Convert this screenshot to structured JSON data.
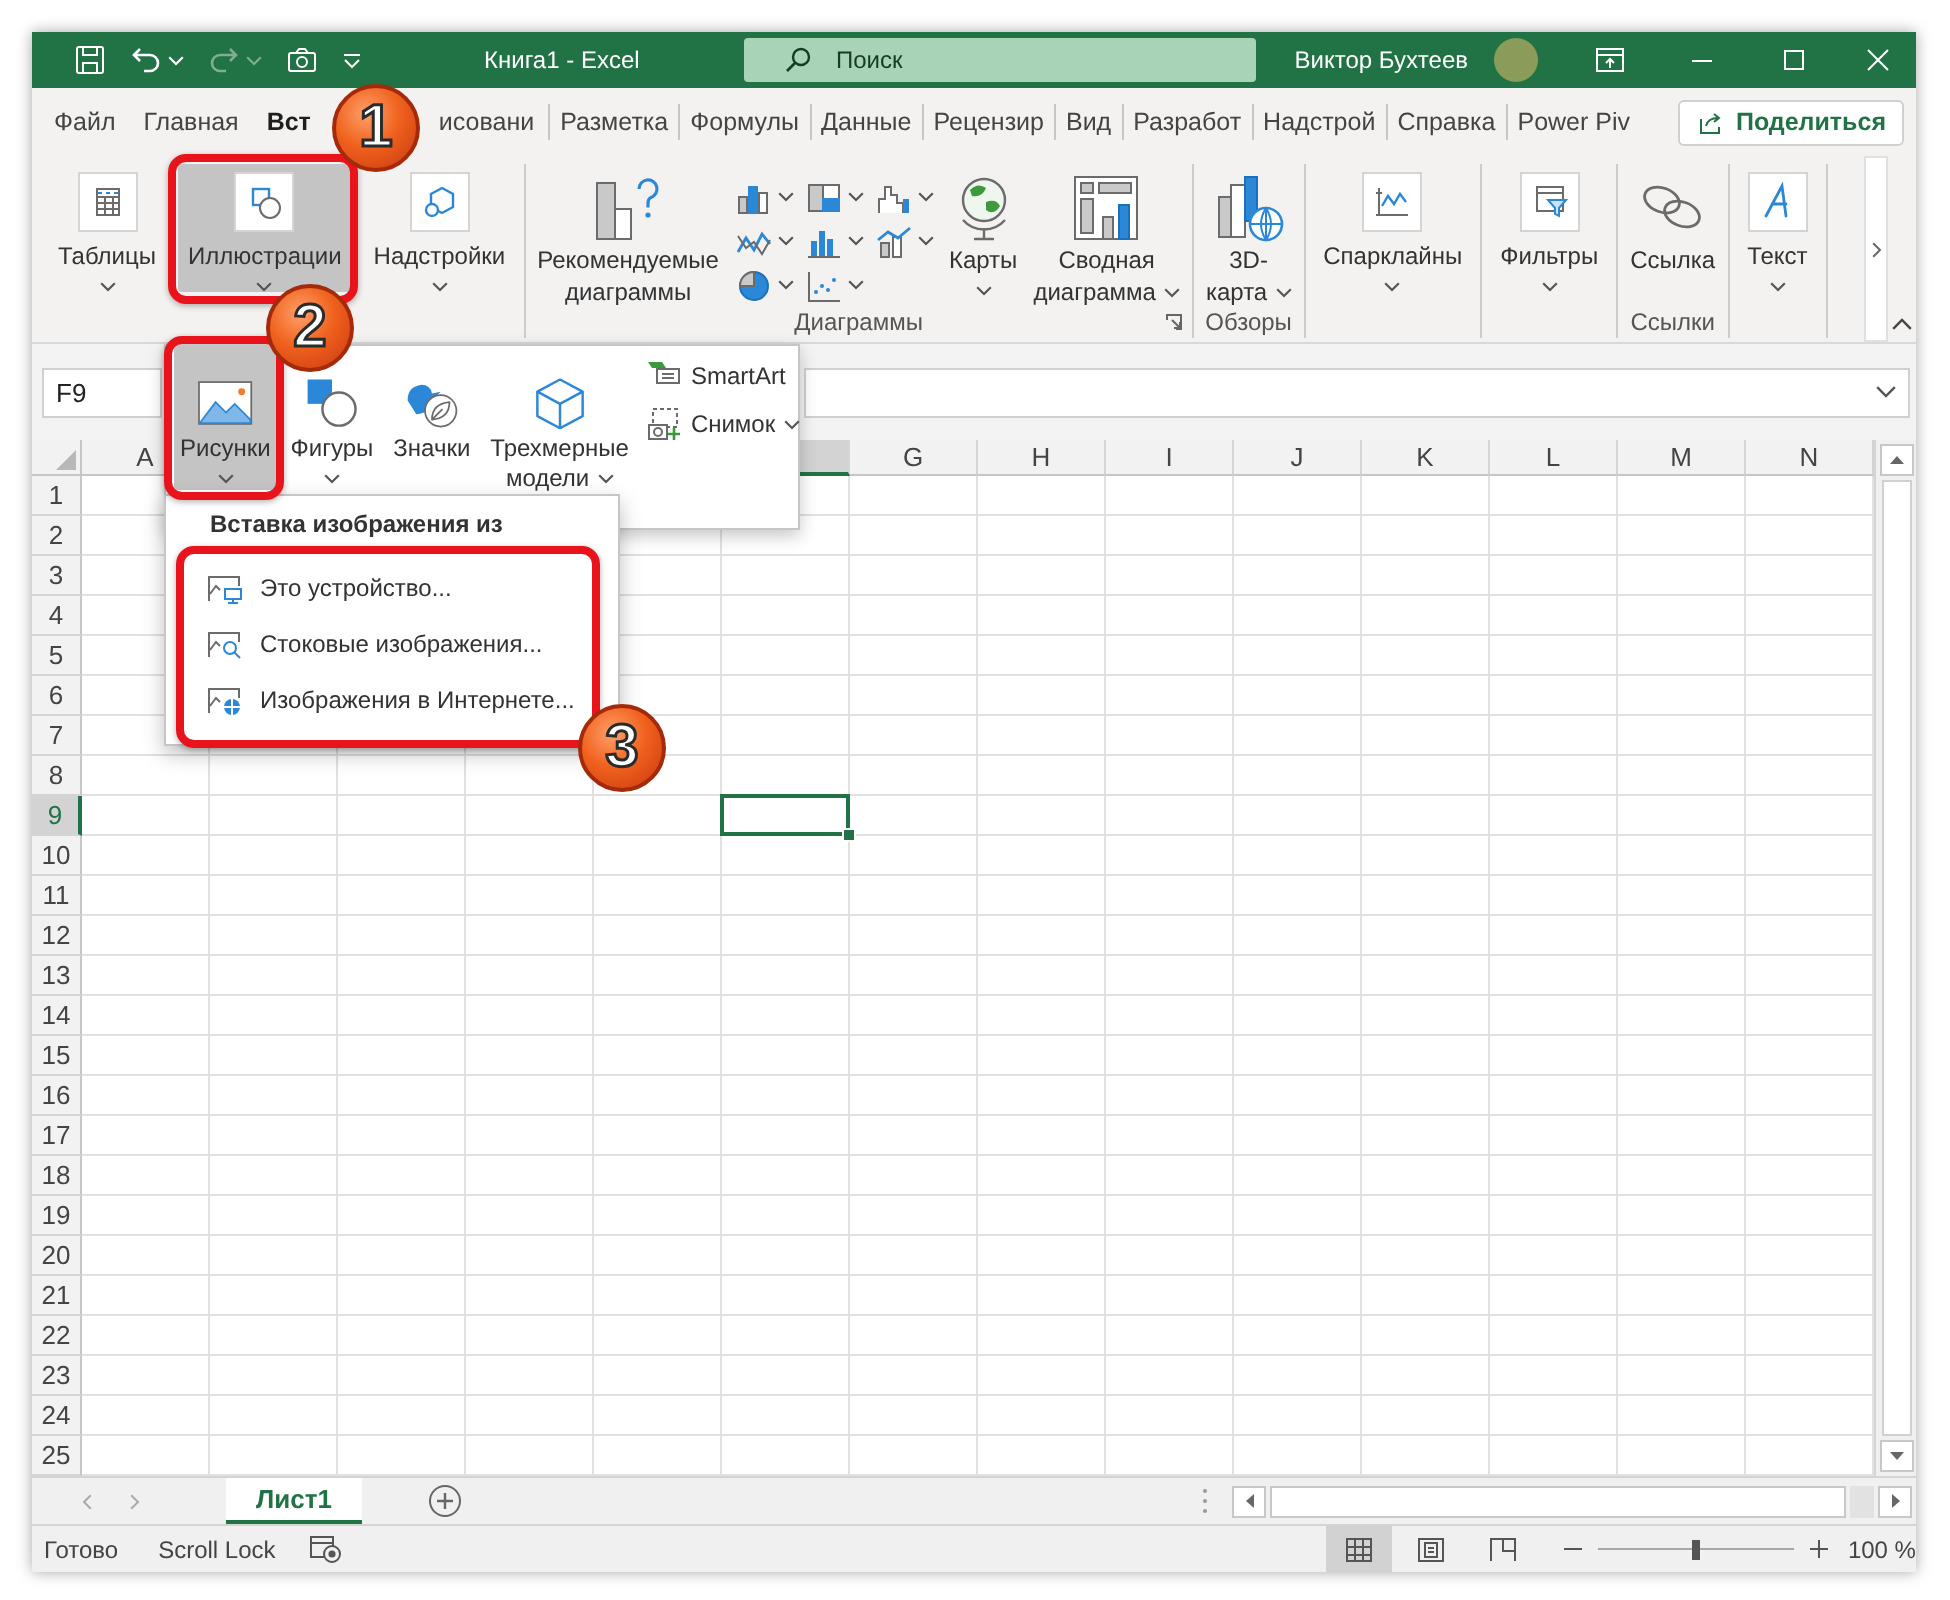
{
  "title_bar": {
    "quick_access": [
      {
        "disabled": false,
        "dropdown": false
      },
      {
        "disabled": false,
        "dropdown": true
      },
      {
        "disabled": true,
        "dropdown": true
      },
      {
        "disabled": false,
        "dropdown": false
      },
      {
        "disabled": false,
        "dropdown": false
      }
    ],
    "title": "Книга1 - Excel",
    "search": {
      "placeholder": "Поиск"
    },
    "user": "Виктор Бухтеев"
  },
  "ribbon_tabs": [
    {
      "label": "Файл",
      "selected": false
    },
    {
      "label": "Главная",
      "selected": false
    },
    {
      "label": "Вст",
      "selected": true
    },
    {
      "label": "исовани",
      "selected": false
    },
    {
      "label": "Разметка",
      "selected": false
    },
    {
      "label": "Формулы",
      "selected": false
    },
    {
      "label": "Данные",
      "selected": false
    },
    {
      "label": "Рецензир",
      "selected": false
    },
    {
      "label": "Вид",
      "selected": false
    },
    {
      "label": "Разработ",
      "selected": false
    },
    {
      "label": "Надстрой",
      "selected": false
    },
    {
      "label": "Справка",
      "selected": false
    },
    {
      "label": "Power Piv",
      "selected": false
    }
  ],
  "share_button": "Поделиться",
  "ribbon_groups": [
    {
      "buttons": [
        {
          "kind": "tile",
          "label": "Таблицы",
          "dropdown": true,
          "pressed": false
        },
        {
          "kind": "tile",
          "label": "Иллюстрации",
          "dropdown": true,
          "pressed": true
        },
        {
          "kind": "tile",
          "label": "Надстройки",
          "dropdown": true,
          "pressed": false
        }
      ]
    },
    {
      "label": "Диаграммы",
      "launcher": true,
      "buttons": [
        {
          "kind": "large",
          "label": "Рекомендуемые\nдиаграммы",
          "dropdown": false,
          "pressed": false
        },
        {
          "kind": "chart-grid",
          "items": [
            {
              "dropdown": true
            },
            {
              "dropdown": true
            },
            {
              "dropdown": true
            },
            {
              "dropdown": true
            },
            {
              "dropdown": true
            },
            {
              "dropdown": true
            },
            {
              "dropdown": true
            },
            {
              "dropdown": true
            }
          ]
        },
        {
          "kind": "large",
          "label": "Карты",
          "dropdown": true,
          "pressed": false
        },
        {
          "kind": "large",
          "label": "Сводная\nдиаграмма",
          "dropdown": true,
          "pressed": false
        }
      ]
    },
    {
      "label": "Обзоры",
      "buttons": [
        {
          "kind": "large",
          "label": "3D-\nкарта",
          "dropdown": true,
          "pressed": false
        }
      ]
    },
    {
      "buttons": [
        {
          "kind": "tile",
          "label": "Спарклайны",
          "dropdown": true,
          "pressed": false
        }
      ]
    },
    {
      "buttons": [
        {
          "kind": "tile",
          "label": "Фильтры",
          "dropdown": true,
          "pressed": false
        }
      ]
    },
    {
      "label": "Ссылки",
      "buttons": [
        {
          "kind": "large",
          "label": "Ссылка",
          "dropdown": false,
          "pressed": false
        }
      ]
    },
    {
      "buttons": [
        {
          "kind": "tile",
          "label": "Текст",
          "dropdown": true,
          "pressed": false
        }
      ]
    }
  ],
  "formula_bar": {
    "name_box": "F9"
  },
  "illustrations_menu": {
    "buttons": [
      {
        "label": "Рисунки",
        "dropdown": true,
        "pressed": true
      },
      {
        "label": "Фигуры",
        "dropdown": true,
        "pressed": false
      },
      {
        "label": "Значки",
        "dropdown": false,
        "pressed": false
      },
      {
        "label": "Трехмерные\nмодели",
        "dropdown": true,
        "pressed": false
      }
    ],
    "side_buttons": [
      {
        "label": "SmartArt",
        "dropdown": false
      },
      {
        "label": "Снимок",
        "dropdown": true
      }
    ]
  },
  "pictures_menu": {
    "header": "Вставка изображения из",
    "items": [
      "Это устройство...",
      "Стоковые изображения...",
      "Изображения в Интернете..."
    ]
  },
  "columns": [
    {
      "label": "A",
      "selected": false
    },
    {},
    {},
    {},
    {},
    {
      "selected": true
    },
    {
      "label": "G",
      "selected": false
    },
    {
      "label": "H",
      "selected": false
    },
    {
      "label": "I",
      "selected": false
    },
    {
      "label": "J",
      "selected": false
    },
    {
      "label": "K",
      "selected": false
    },
    {
      "label": "L",
      "selected": false
    },
    {
      "label": "M",
      "selected": false
    },
    {
      "label": "N",
      "selected": false
    }
  ],
  "rows": [
    {
      "label": "1",
      "selected": false
    },
    {
      "label": "2",
      "selected": false
    },
    {
      "label": "3",
      "selected": false
    },
    {
      "label": "4",
      "selected": false
    },
    {
      "label": "5",
      "selected": false
    },
    {
      "label": "6",
      "selected": false
    },
    {
      "label": "7",
      "selected": false
    },
    {
      "label": "8",
      "selected": false
    },
    {
      "label": "9",
      "selected": true
    },
    {
      "label": "10",
      "selected": false
    },
    {
      "label": "11",
      "selected": false
    },
    {
      "label": "12",
      "selected": false
    },
    {
      "label": "13",
      "selected": false
    },
    {
      "label": "14",
      "selected": false
    },
    {
      "label": "15",
      "selected": false
    },
    {
      "label": "16",
      "selected": false
    },
    {
      "label": "17",
      "selected": false
    },
    {
      "label": "18",
      "selected": false
    },
    {
      "label": "19",
      "selected": false
    },
    {
      "label": "20",
      "selected": false
    },
    {
      "label": "21",
      "selected": false
    },
    {
      "label": "22",
      "selected": false
    },
    {
      "label": "23",
      "selected": false
    },
    {
      "label": "24",
      "selected": false
    },
    {
      "label": "25",
      "selected": false
    }
  ],
  "sheet_tabs": [
    {
      "label": "Лист1",
      "selected": true
    }
  ],
  "status_bar": {
    "status": "Готово",
    "scroll_lock": "Scroll Lock",
    "views": [
      {
        "selected": true
      },
      {
        "selected": false
      },
      {
        "selected": false
      }
    ],
    "zoom": {
      "level": 0.5,
      "reading": "100 %"
    }
  },
  "callouts": [
    {
      "number": "1"
    },
    {
      "number": "2"
    },
    {
      "number": "3"
    }
  ]
}
